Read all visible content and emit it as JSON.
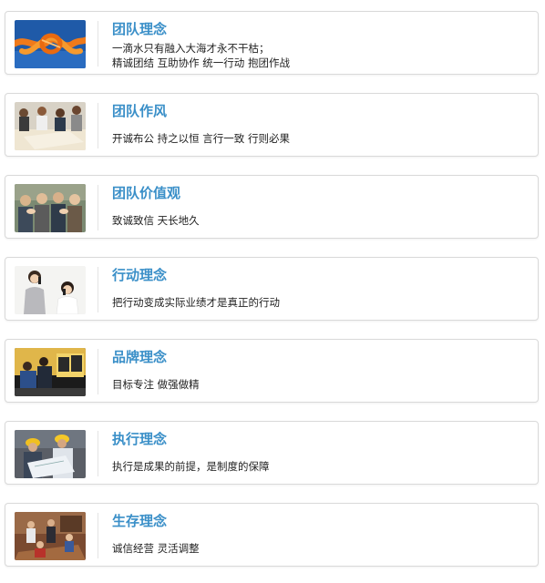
{
  "items": [
    {
      "icon": "rope-knot-icon",
      "title": "团队理念",
      "lines": [
        "一滴水只有融入大海才永不干枯；",
        "精诚团结 互助协作 统一行动 抱团作战"
      ]
    },
    {
      "icon": "team-meeting-photo",
      "title": "团队作风",
      "lines": [
        "开诚布公 持之以恒 言行一致 行则必果"
      ]
    },
    {
      "icon": "applause-photo",
      "title": "团队价值观",
      "lines": [
        "致诚致信 天长地久"
      ]
    },
    {
      "icon": "phone-call-photo",
      "title": "行动理念",
      "lines": [
        "把行动变成实际业绩才是真正的行动"
      ]
    },
    {
      "icon": "office-work-photo",
      "title": "品牌理念",
      "lines": [
        "目标专注 做强做精"
      ]
    },
    {
      "icon": "engineers-blueprint-photo",
      "title": "执行理念",
      "lines": [
        "执行是成果的前提，是制度的保障"
      ]
    },
    {
      "icon": "business-meeting-photo",
      "title": "生存理念",
      "lines": [
        "诚信经营 灵活调整"
      ]
    }
  ],
  "colors": {
    "title": "#3a8fc8",
    "text": "#222222",
    "border": "#d9d9d9"
  }
}
